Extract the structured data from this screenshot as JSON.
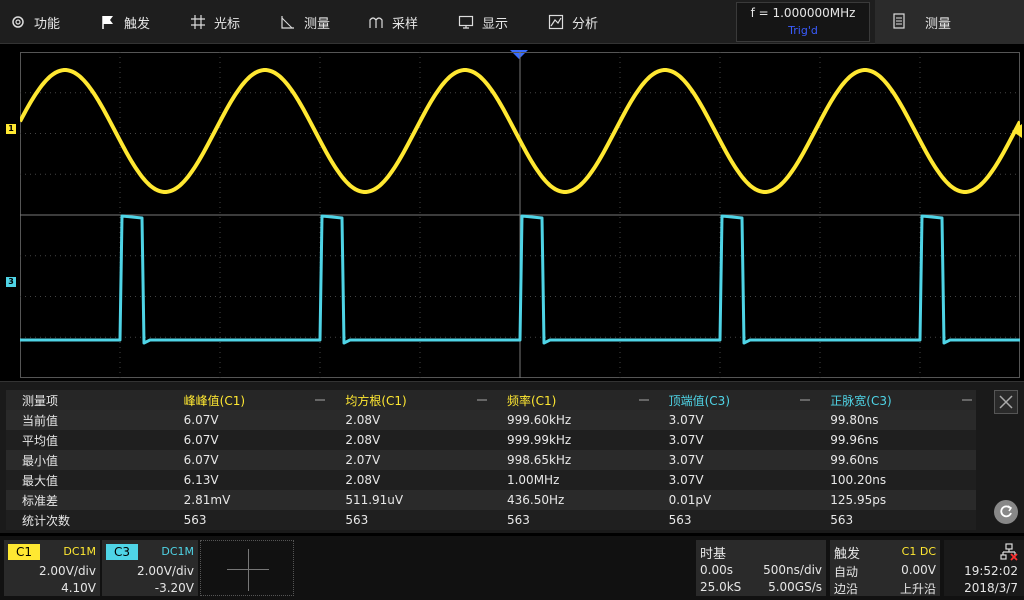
{
  "menu": {
    "items": [
      {
        "label": "功能",
        "icon": "gear-icon"
      },
      {
        "label": "触发",
        "icon": "flag-icon"
      },
      {
        "label": "光标",
        "icon": "crosshair-icon"
      },
      {
        "label": "测量",
        "icon": "ruler-icon"
      },
      {
        "label": "采样",
        "icon": "sampling-icon"
      },
      {
        "label": "显示",
        "icon": "monitor-icon"
      },
      {
        "label": "分析",
        "icon": "analysis-icon"
      }
    ],
    "frequency": "f = 1.000000MHz",
    "trig_status": "Trig'd",
    "measure_button": "测量"
  },
  "scope": {
    "channel_markers": [
      {
        "label": "1",
        "color": "#ffe832"
      },
      {
        "label": "3",
        "color": "#4fd4e6"
      }
    ]
  },
  "measure_table": {
    "header": [
      "测量项",
      "峰峰值(C1)",
      "均方根(C1)",
      "频率(C1)",
      "顶端值(C3)",
      "正脉宽(C3)"
    ],
    "header_colors": [
      "",
      "#ffe832",
      "#ffe832",
      "#ffe832",
      "#4fd4e6",
      "#4fd4e6"
    ],
    "rows": [
      [
        "当前值",
        "6.07V",
        "2.08V",
        "999.60kHz",
        "3.07V",
        "99.80ns"
      ],
      [
        "平均值",
        "6.07V",
        "2.08V",
        "999.99kHz",
        "3.07V",
        "99.96ns"
      ],
      [
        "最小值",
        "6.07V",
        "2.07V",
        "998.65kHz",
        "3.07V",
        "99.60ns"
      ],
      [
        "最大值",
        "6.13V",
        "2.08V",
        "1.00MHz",
        "3.07V",
        "100.20ns"
      ],
      [
        "标准差",
        "2.81mV",
        "511.91uV",
        "436.50Hz",
        "0.01pV",
        "125.95ps"
      ],
      [
        "统计次数",
        "563",
        "563",
        "563",
        "563",
        "563"
      ]
    ]
  },
  "channels": [
    {
      "tag": "C1",
      "coupling": "DC1M",
      "vdiv": "2.00V/div",
      "offset": "4.10V",
      "color": "#ffe832"
    },
    {
      "tag": "C3",
      "coupling": "DC1M",
      "vdiv": "2.00V/div",
      "offset": "-3.20V",
      "color": "#4fd4e6"
    }
  ],
  "timebase": {
    "title": "时基",
    "delay": "0.00s",
    "tdiv": "500ns/div",
    "mem": "25.0kS",
    "rate": "5.00GS/s"
  },
  "trigger": {
    "title": "触发",
    "source": "C1 DC",
    "mode": "自动",
    "level": "0.00V",
    "type": "边沿",
    "slope": "上升沿"
  },
  "clock": {
    "time": "19:52:02",
    "date": "2018/3/7"
  }
}
